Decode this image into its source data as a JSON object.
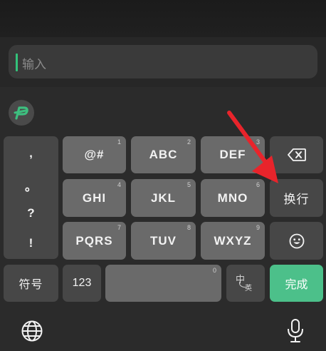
{
  "input": {
    "placeholder": "输入"
  },
  "keyboard": {
    "punctuation": [
      ",",
      "。",
      "?",
      "!"
    ],
    "rows": [
      [
        {
          "label": "@#",
          "num": "1"
        },
        {
          "label": "ABC",
          "num": "2"
        },
        {
          "label": "DEF",
          "num": "3"
        }
      ],
      [
        {
          "label": "GHI",
          "num": "4"
        },
        {
          "label": "JKL",
          "num": "5"
        },
        {
          "label": "MNO",
          "num": "6"
        }
      ],
      [
        {
          "label": "PQRS",
          "num": "7"
        },
        {
          "label": "TUV",
          "num": "8"
        },
        {
          "label": "WXYZ",
          "num": "9"
        }
      ]
    ],
    "newline_label": "换行",
    "symbols_label": "符号",
    "numeric_label": "123",
    "space_num": "0",
    "lang_toggle": {
      "primary": "中",
      "secondary": "英"
    },
    "done_label": "完成"
  },
  "icons": {
    "logo": "pinyin-logo-icon",
    "backspace": "backspace-icon",
    "emoji": "smiley-emoji-icon",
    "globe": "globe-icon",
    "mic": "microphone-icon",
    "annotation": "red-arrow-icon"
  },
  "colors": {
    "accent": "#4cc08a",
    "cursor": "#33c27a",
    "arrow": "#e8242b"
  }
}
